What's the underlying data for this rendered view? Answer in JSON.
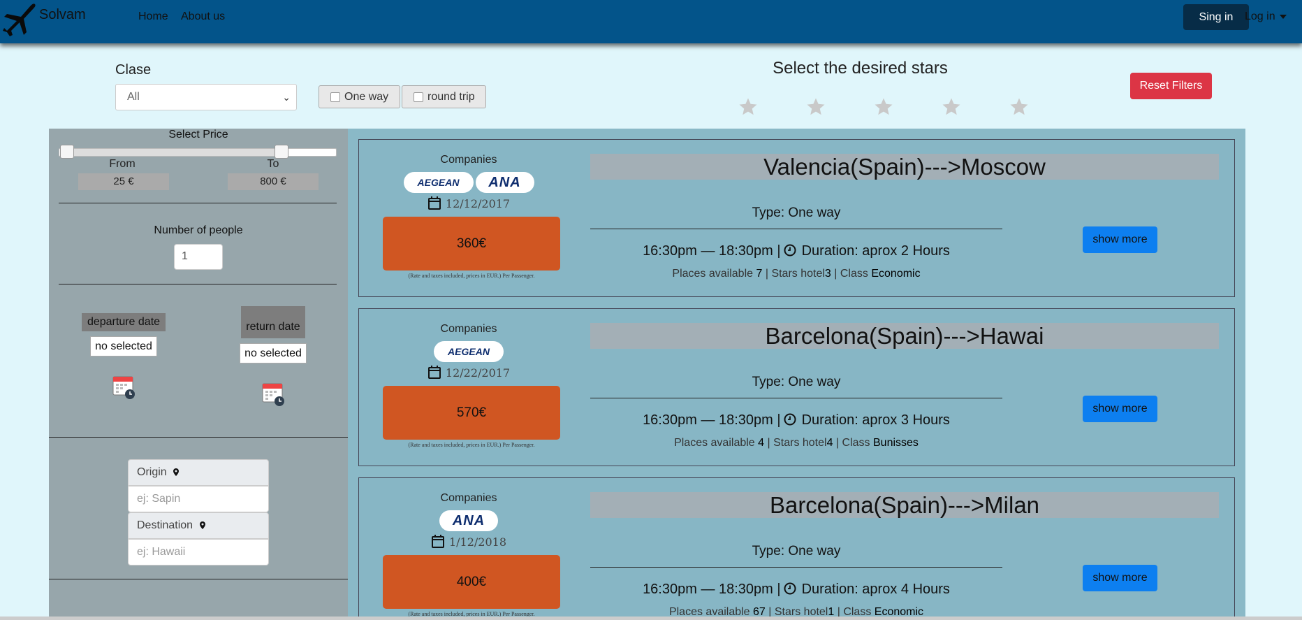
{
  "nav": {
    "brand": "Solvam",
    "links": [
      "Home",
      "About us"
    ],
    "signin": "Sing in",
    "login": "Log in"
  },
  "filters": {
    "clase_label": "Clase",
    "clase_value": "All",
    "one_way": "One way",
    "round_trip": "round trip",
    "stars_title": "Select the desired stars",
    "stars_count": 5,
    "reset": "Reset Filters"
  },
  "sidebar": {
    "price_title": "Select Price",
    "from_label": "From",
    "to_label": "To",
    "from_value": "25 €",
    "to_value": "800 €",
    "people_label": "Number of people",
    "people_value": "1",
    "departure_label": "departure date",
    "departure_value": "no selected",
    "return_label": "return date",
    "return_value": "no selected",
    "origin_label": "Origin",
    "origin_placeholder": "ej: Sapin",
    "destination_label": "Destination",
    "destination_placeholder": "ej: Hawaii"
  },
  "card_labels": {
    "companies": "Companies",
    "rate_note": "(Rate and taxes included, prices in EUR.) Per Passenger.",
    "show_more": "show more"
  },
  "flights": [
    {
      "route": "Valencia(Spain)--->Moscow",
      "date": "12/12/2017",
      "price": "360€",
      "type": "Type: One way",
      "times": "16:30pm — 18:30pm |",
      "duration": "Duration: aprox 2 Hours",
      "places_label": "Places available",
      "places": "7",
      "stars_label": "Stars hotel",
      "stars": "3",
      "class_label": "Class",
      "class": "Economic",
      "companies": [
        "AEGEAN",
        "ANA"
      ]
    },
    {
      "route": "Barcelona(Spain)--->Hawai",
      "date": "12/22/2017",
      "price": "570€",
      "type": "Type: One way",
      "times": "16:30pm — 18:30pm |",
      "duration": "Duration: aprox 3 Hours",
      "places_label": "Places available",
      "places": "4",
      "stars_label": "Stars hotel",
      "stars": "4",
      "class_label": "Class",
      "class": "Bunisses",
      "companies": [
        "AEGEAN"
      ]
    },
    {
      "route": "Barcelona(Spain)--->Milan",
      "date": "1/12/2018",
      "price": "400€",
      "type": "Type: One way",
      "times": "16:30pm — 18:30pm |",
      "duration": "Duration: aprox 4 Hours",
      "places_label": "Places available",
      "places": "67",
      "stars_label": "Stars hotel",
      "stars": "1",
      "class_label": "Class",
      "class": "Economic",
      "companies": [
        "ANA"
      ]
    }
  ],
  "colors": {
    "navbar": "#03548a",
    "page_bg": "#e0f6fb",
    "sidebar": "#97a6ab",
    "results": "#8ab9c7",
    "price_button": "#d05622",
    "show_more": "#0d7ff0",
    "reset": "#dc3545"
  }
}
